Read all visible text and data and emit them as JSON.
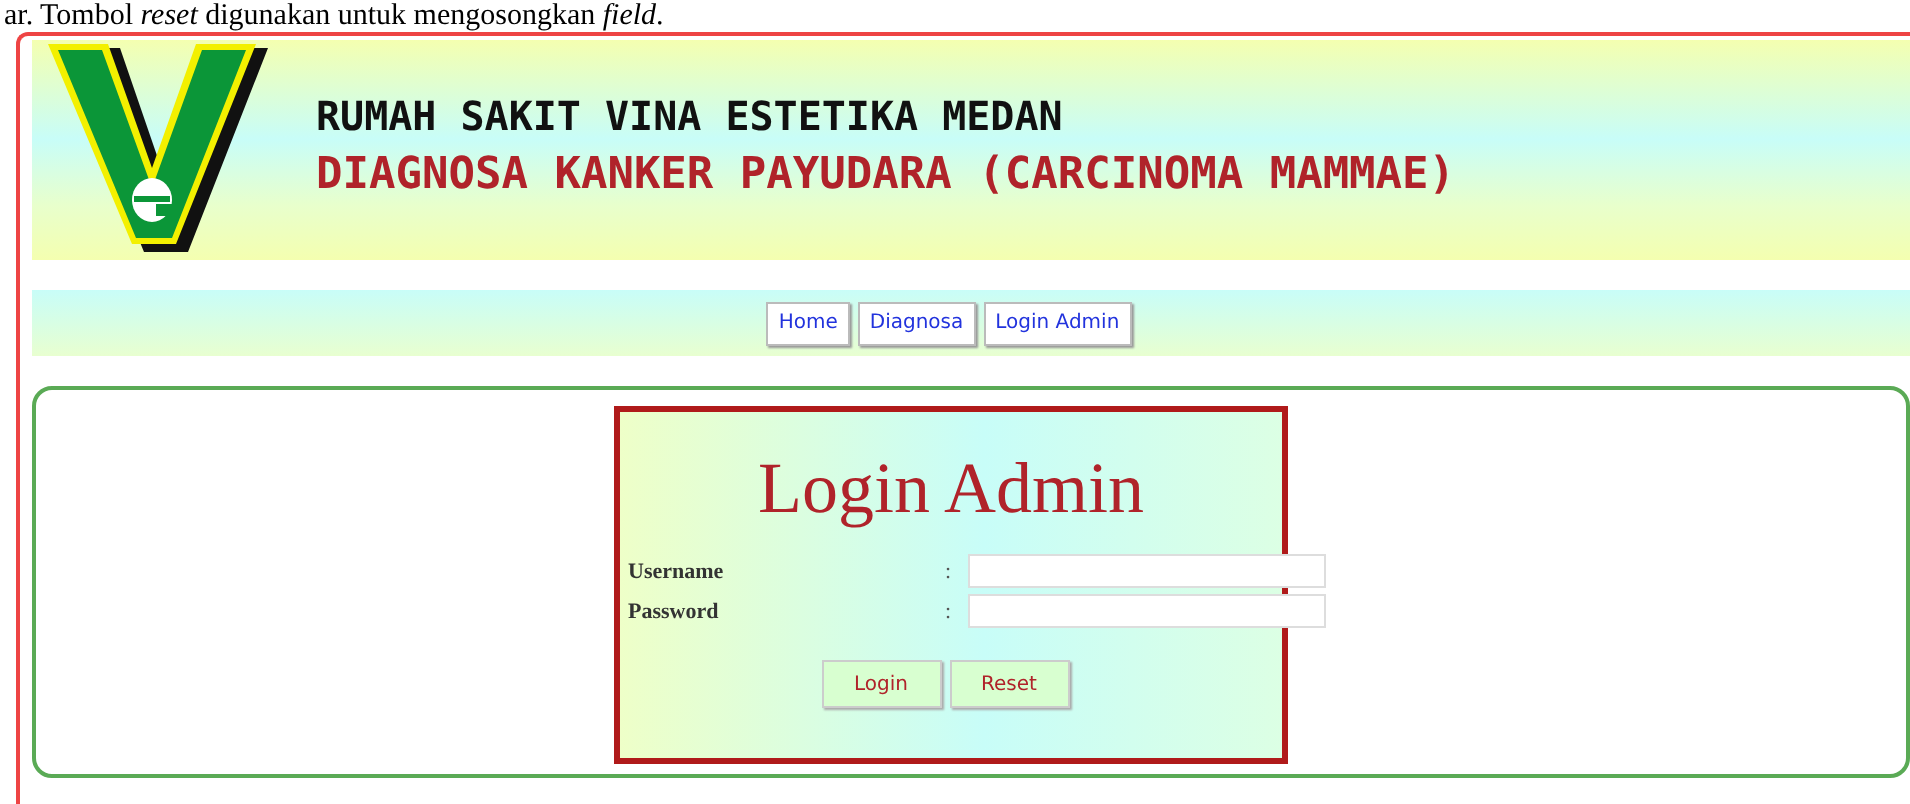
{
  "caption": "ar. Tombol *reset* digunakan untuk mengosongkan *field*.",
  "header": {
    "title": "RUMAH SAKIT VINA ESTETIKA MEDAN",
    "subtitle": "DIAGNOSA KANKER PAYUDARA (CARCINOMA MAMMAE)"
  },
  "nav": [
    {
      "label": "Home"
    },
    {
      "label": "Diagnosa"
    },
    {
      "label": "Login Admin"
    }
  ],
  "login": {
    "title": "Login Admin",
    "fields": [
      {
        "label": "Username",
        "separator": ":"
      },
      {
        "label": "Password",
        "separator": ":"
      }
    ],
    "buttons": [
      {
        "label": "Login"
      },
      {
        "label": "Reset"
      }
    ]
  }
}
